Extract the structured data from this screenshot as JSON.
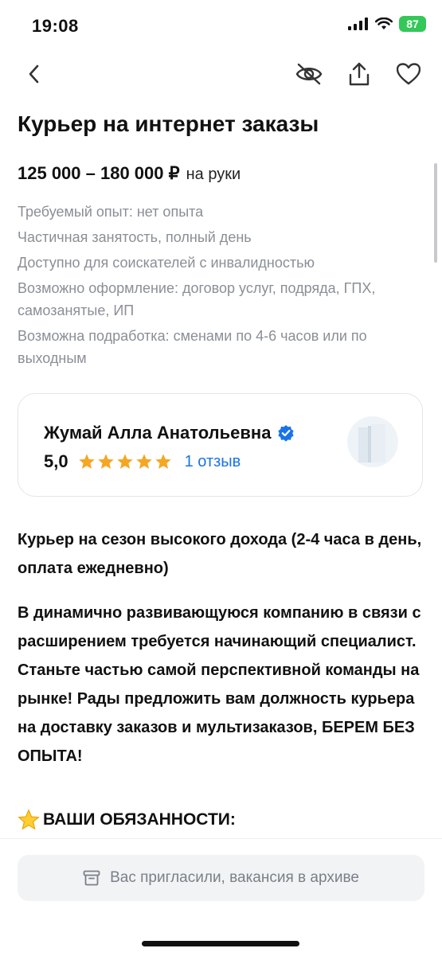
{
  "status": {
    "time": "19:08",
    "battery": "87"
  },
  "vacancy": {
    "title": "Курьер на интернет заказы",
    "salary": "125 000 – 180 000 ₽",
    "salary_note": "на руки",
    "details": [
      "Требуемый опыт: нет опыта",
      "Частичная занятость, полный день",
      "Доступно для соискателей с инвалидностью",
      "Возможно оформление: договор услуг, подряда, ГПХ, самозанятые, ИП",
      "Возможна подработка: сменами по 4-6 часов или по выходным"
    ]
  },
  "employer": {
    "name": "Жумай Алла Анатольевна",
    "rating": "5,0",
    "stars": 5,
    "reviews": "1 отзыв"
  },
  "description": {
    "p1": "Курьер на сезон высокого дохода (2-4 часа в день, оплата ежедневно)",
    "p2": "В динамично развивающуюся компанию в связи с расширением требуется начинающий специалист. Станьте частью самой перспективной команды на рынке! Рады предложить вам должность курьера на доставку заказов и мультизаказов, БЕРЕМ БЕЗ ОПЫТА!",
    "duties_heading": "ВАШИ ОБЯЗАННОСТИ:"
  },
  "footer": {
    "archive_label": "Вас пригласили, вакансия в архиве"
  },
  "colors": {
    "accent": "#1a73e8",
    "star": "#f5a623",
    "muted": "#8a8f96",
    "battery": "#34c759"
  },
  "icons": [
    "back-icon",
    "hide-icon",
    "share-icon",
    "favorite-icon",
    "verified-icon",
    "star-icon",
    "archive-icon"
  ]
}
